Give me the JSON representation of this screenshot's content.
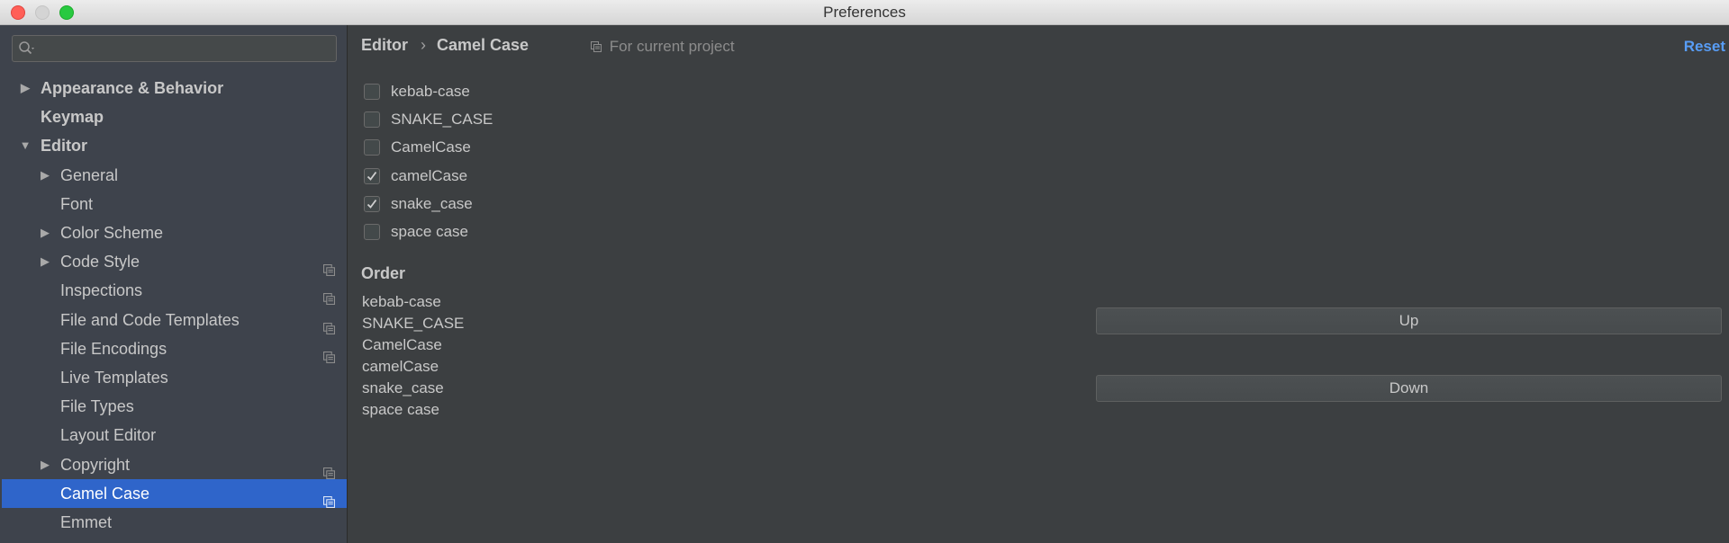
{
  "window": {
    "title": "Preferences"
  },
  "search": {
    "value": "",
    "placeholder": ""
  },
  "sidebar": {
    "items": [
      {
        "label": "Appearance & Behavior",
        "arrow": "▶"
      },
      {
        "label": "Keymap"
      },
      {
        "label": "Editor",
        "arrow": "▼"
      },
      {
        "label": "General",
        "arrow": "▶"
      },
      {
        "label": "Font"
      },
      {
        "label": "Color Scheme",
        "arrow": "▶"
      },
      {
        "label": "Code Style",
        "arrow": "▶"
      },
      {
        "label": "Inspections"
      },
      {
        "label": "File and Code Templates"
      },
      {
        "label": "File Encodings"
      },
      {
        "label": "Live Templates"
      },
      {
        "label": "File Types"
      },
      {
        "label": "Layout Editor"
      },
      {
        "label": "Copyright",
        "arrow": "▶"
      },
      {
        "label": "Camel Case"
      },
      {
        "label": "Emmet"
      }
    ],
    "selected_index": 14
  },
  "header": {
    "breadcrumb_parent": "Editor",
    "breadcrumb_separator": "›",
    "breadcrumb_current": "Camel Case",
    "scope_label": "For current project",
    "reset_label": "Reset"
  },
  "checkboxes": [
    {
      "label": "kebab-case",
      "checked": false
    },
    {
      "label": "SNAKE_CASE",
      "checked": false
    },
    {
      "label": "CamelCase",
      "checked": false
    },
    {
      "label": "camelCase",
      "checked": true
    },
    {
      "label": "snake_case",
      "checked": true
    },
    {
      "label": "space case",
      "checked": false
    }
  ],
  "order": {
    "heading": "Order",
    "items": [
      "kebab-case",
      "SNAKE_CASE",
      "CamelCase",
      "camelCase",
      "snake_case",
      "space case"
    ]
  },
  "buttons": {
    "up_label": "Up",
    "down_label": "Down"
  },
  "colors": {
    "selection": "#2f65ca",
    "link": "#589df6",
    "sidebar_bg": "#3e434c",
    "panel_bg": "#3c3f41"
  }
}
